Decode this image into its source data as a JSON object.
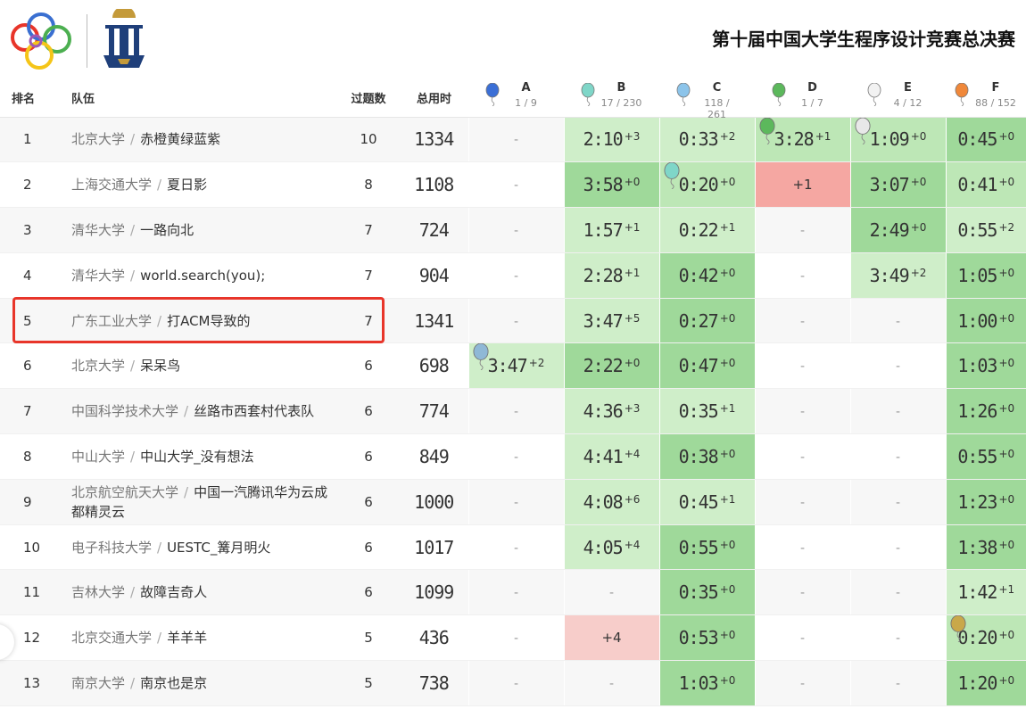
{
  "contest_title": "第十届中国大学生程序设计竞赛总决赛",
  "columns": {
    "rank": "排名",
    "team": "队伍",
    "solved": "过题数",
    "time": "总用时"
  },
  "problems": [
    {
      "letter": "A",
      "stat": "1 / 9",
      "color": "#3b6fd6"
    },
    {
      "letter": "B",
      "stat": "17 / 230",
      "color": "#7fd6c8"
    },
    {
      "letter": "C",
      "stat": "118 / 261",
      "color": "#8cc4ea"
    },
    {
      "letter": "D",
      "stat": "1 / 7",
      "color": "#5cb85c"
    },
    {
      "letter": "E",
      "stat": "4 / 12",
      "color": "#f2f2f2"
    },
    {
      "letter": "F",
      "stat": "88 / 152",
      "color": "#f0883a"
    }
  ],
  "rows": [
    {
      "rank": "1",
      "school": "北京大学",
      "team": "赤橙黄绿蓝紫",
      "solved": "10",
      "time": "1334",
      "cells": [
        {
          "s": "none"
        },
        {
          "s": "ac2",
          "t": "2:10",
          "n": "+3"
        },
        {
          "s": "ac2",
          "t": "0:33",
          "n": "+2"
        },
        {
          "s": "ac",
          "t": "3:28",
          "n": "+1",
          "fb": "#5cb85c"
        },
        {
          "s": "ac",
          "t": "1:09",
          "n": "+0",
          "fb": "#e8e8e8"
        },
        {
          "s": "first",
          "t": "0:45",
          "n": "+0"
        }
      ]
    },
    {
      "rank": "2",
      "school": "上海交通大学",
      "team": "夏日影",
      "solved": "8",
      "time": "1108",
      "cells": [
        {
          "s": "none"
        },
        {
          "s": "first",
          "t": "3:58",
          "n": "+0"
        },
        {
          "s": "ac",
          "t": "0:20",
          "n": "+0",
          "fb": "#7fd6c8"
        },
        {
          "s": "wa",
          "w": "+1"
        },
        {
          "s": "first",
          "t": "3:07",
          "n": "+0"
        },
        {
          "s": "ac",
          "t": "0:41",
          "n": "+0"
        }
      ]
    },
    {
      "rank": "3",
      "school": "清华大学",
      "team": "一路向北",
      "solved": "7",
      "time": "724",
      "cells": [
        {
          "s": "none"
        },
        {
          "s": "ac2",
          "t": "1:57",
          "n": "+1"
        },
        {
          "s": "ac2",
          "t": "0:22",
          "n": "+1"
        },
        {
          "s": "none"
        },
        {
          "s": "first",
          "t": "2:49",
          "n": "+0"
        },
        {
          "s": "ac2",
          "t": "0:55",
          "n": "+2"
        }
      ]
    },
    {
      "rank": "4",
      "school": "清华大学",
      "team": "world.search(you);",
      "solved": "7",
      "time": "904",
      "cells": [
        {
          "s": "none"
        },
        {
          "s": "ac2",
          "t": "2:28",
          "n": "+1"
        },
        {
          "s": "first",
          "t": "0:42",
          "n": "+0"
        },
        {
          "s": "none"
        },
        {
          "s": "ac2",
          "t": "3:49",
          "n": "+2"
        },
        {
          "s": "first",
          "t": "1:05",
          "n": "+0"
        }
      ]
    },
    {
      "rank": "5",
      "school": "广东工业大学",
      "team": "打ACM导致的",
      "solved": "7",
      "time": "1341",
      "cells": [
        {
          "s": "none"
        },
        {
          "s": "ac2",
          "t": "3:47",
          "n": "+5"
        },
        {
          "s": "first",
          "t": "0:27",
          "n": "+0"
        },
        {
          "s": "none"
        },
        {
          "s": "none"
        },
        {
          "s": "first",
          "t": "1:00",
          "n": "+0"
        }
      ]
    },
    {
      "rank": "6",
      "school": "北京大学",
      "team": "呆呆鸟",
      "solved": "6",
      "time": "698",
      "cells": [
        {
          "s": "ac2",
          "t": "3:47",
          "n": "+2",
          "fb": "#8fb8d6"
        },
        {
          "s": "first",
          "t": "2:22",
          "n": "+0"
        },
        {
          "s": "first",
          "t": "0:47",
          "n": "+0"
        },
        {
          "s": "none"
        },
        {
          "s": "none"
        },
        {
          "s": "first",
          "t": "1:03",
          "n": "+0"
        }
      ]
    },
    {
      "rank": "7",
      "school": "中国科学技术大学",
      "team": "丝路市西套村代表队",
      "solved": "6",
      "time": "774",
      "cells": [
        {
          "s": "none"
        },
        {
          "s": "ac2",
          "t": "4:36",
          "n": "+3"
        },
        {
          "s": "ac2",
          "t": "0:35",
          "n": "+1"
        },
        {
          "s": "none"
        },
        {
          "s": "none"
        },
        {
          "s": "first",
          "t": "1:26",
          "n": "+0"
        }
      ]
    },
    {
      "rank": "8",
      "school": "中山大学",
      "team": "中山大学_没有想法",
      "solved": "6",
      "time": "849",
      "cells": [
        {
          "s": "none"
        },
        {
          "s": "ac2",
          "t": "4:41",
          "n": "+4"
        },
        {
          "s": "first",
          "t": "0:38",
          "n": "+0"
        },
        {
          "s": "none"
        },
        {
          "s": "none"
        },
        {
          "s": "first",
          "t": "0:55",
          "n": "+0"
        }
      ]
    },
    {
      "rank": "9",
      "school": "北京航空航天大学",
      "team": "中国一汽腾讯华为云成都精灵云",
      "solved": "6",
      "time": "1000",
      "cells": [
        {
          "s": "none"
        },
        {
          "s": "ac2",
          "t": "4:08",
          "n": "+6"
        },
        {
          "s": "ac2",
          "t": "0:45",
          "n": "+1"
        },
        {
          "s": "none"
        },
        {
          "s": "none"
        },
        {
          "s": "first",
          "t": "1:23",
          "n": "+0"
        }
      ]
    },
    {
      "rank": "10",
      "school": "电子科技大学",
      "team": "UESTC_篝月明火",
      "solved": "6",
      "time": "1017",
      "cells": [
        {
          "s": "none"
        },
        {
          "s": "ac2",
          "t": "4:05",
          "n": "+4"
        },
        {
          "s": "first",
          "t": "0:55",
          "n": "+0"
        },
        {
          "s": "none"
        },
        {
          "s": "none"
        },
        {
          "s": "first",
          "t": "1:38",
          "n": "+0"
        }
      ]
    },
    {
      "rank": "11",
      "school": "吉林大学",
      "team": "故障吉奇人",
      "solved": "6",
      "time": "1099",
      "cells": [
        {
          "s": "none"
        },
        {
          "s": "none"
        },
        {
          "s": "first",
          "t": "0:35",
          "n": "+0"
        },
        {
          "s": "none"
        },
        {
          "s": "none"
        },
        {
          "s": "ac2",
          "t": "1:42",
          "n": "+1"
        }
      ]
    },
    {
      "rank": "12",
      "school": "北京交通大学",
      "team": "羊羊羊",
      "solved": "5",
      "time": "436",
      "cells": [
        {
          "s": "none"
        },
        {
          "s": "wa2",
          "w": "+4"
        },
        {
          "s": "first",
          "t": "0:53",
          "n": "+0"
        },
        {
          "s": "none"
        },
        {
          "s": "none"
        },
        {
          "s": "ac",
          "t": "0:20",
          "n": "+0",
          "fb": "#c9a84a"
        }
      ]
    },
    {
      "rank": "13",
      "school": "南京大学",
      "team": "南京也是京",
      "solved": "5",
      "time": "738",
      "cells": [
        {
          "s": "none"
        },
        {
          "s": "none"
        },
        {
          "s": "first",
          "t": "1:03",
          "n": "+0"
        },
        {
          "s": "none"
        },
        {
          "s": "none"
        },
        {
          "s": "first",
          "t": "1:20",
          "n": "+0"
        }
      ]
    }
  ]
}
